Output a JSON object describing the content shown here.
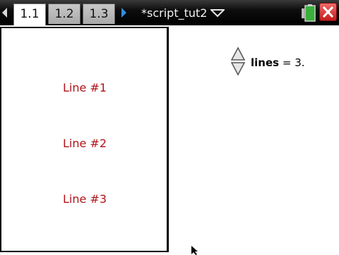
{
  "tabs": [
    {
      "label": "1.1",
      "active": true
    },
    {
      "label": "1.2",
      "active": false
    },
    {
      "label": "1.3",
      "active": false
    }
  ],
  "document": {
    "title": "*script_tut2"
  },
  "left_pane": {
    "lines": [
      "Line #1",
      "Line #2",
      "Line #3"
    ]
  },
  "right_pane": {
    "variable_name": "lines",
    "equals": "=",
    "variable_value": "3."
  },
  "colors": {
    "line_text": "#b0141a",
    "topbar": "#000000",
    "nav_arrow": "#2e8fe0",
    "battery": "#3ab03a",
    "close": "#d42a2a"
  },
  "icons": [
    "left-arrow-icon",
    "right-arrow-icon",
    "chevron-down-icon",
    "battery-icon",
    "close-icon",
    "slider-updown-icon",
    "mouse-cursor-icon"
  ]
}
